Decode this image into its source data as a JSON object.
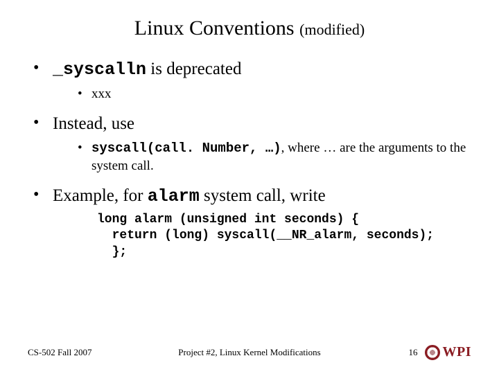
{
  "title": {
    "main": "Linux Conventions",
    "sub": "(modified)"
  },
  "bullets": {
    "b1": {
      "code": "_syscalln",
      "rest": " is deprecated",
      "sub1": "xxx"
    },
    "b2": {
      "text": "Instead, use",
      "sub1_code": "syscall(call. Number, …)",
      "sub1_rest": ", where … are the arguments to the system call."
    },
    "b3": {
      "prefix": "Example, for ",
      "code": "alarm",
      "suffix": " system call, write",
      "codeblock": "long alarm (unsigned int seconds) {\n  return (long) syscall(__NR_alarm, seconds);\n  };"
    }
  },
  "footer": {
    "left": "CS-502 Fall 2007",
    "center": "Project #2, Linux Kernel Modifications",
    "page": "16",
    "logo_text": "WPI"
  }
}
